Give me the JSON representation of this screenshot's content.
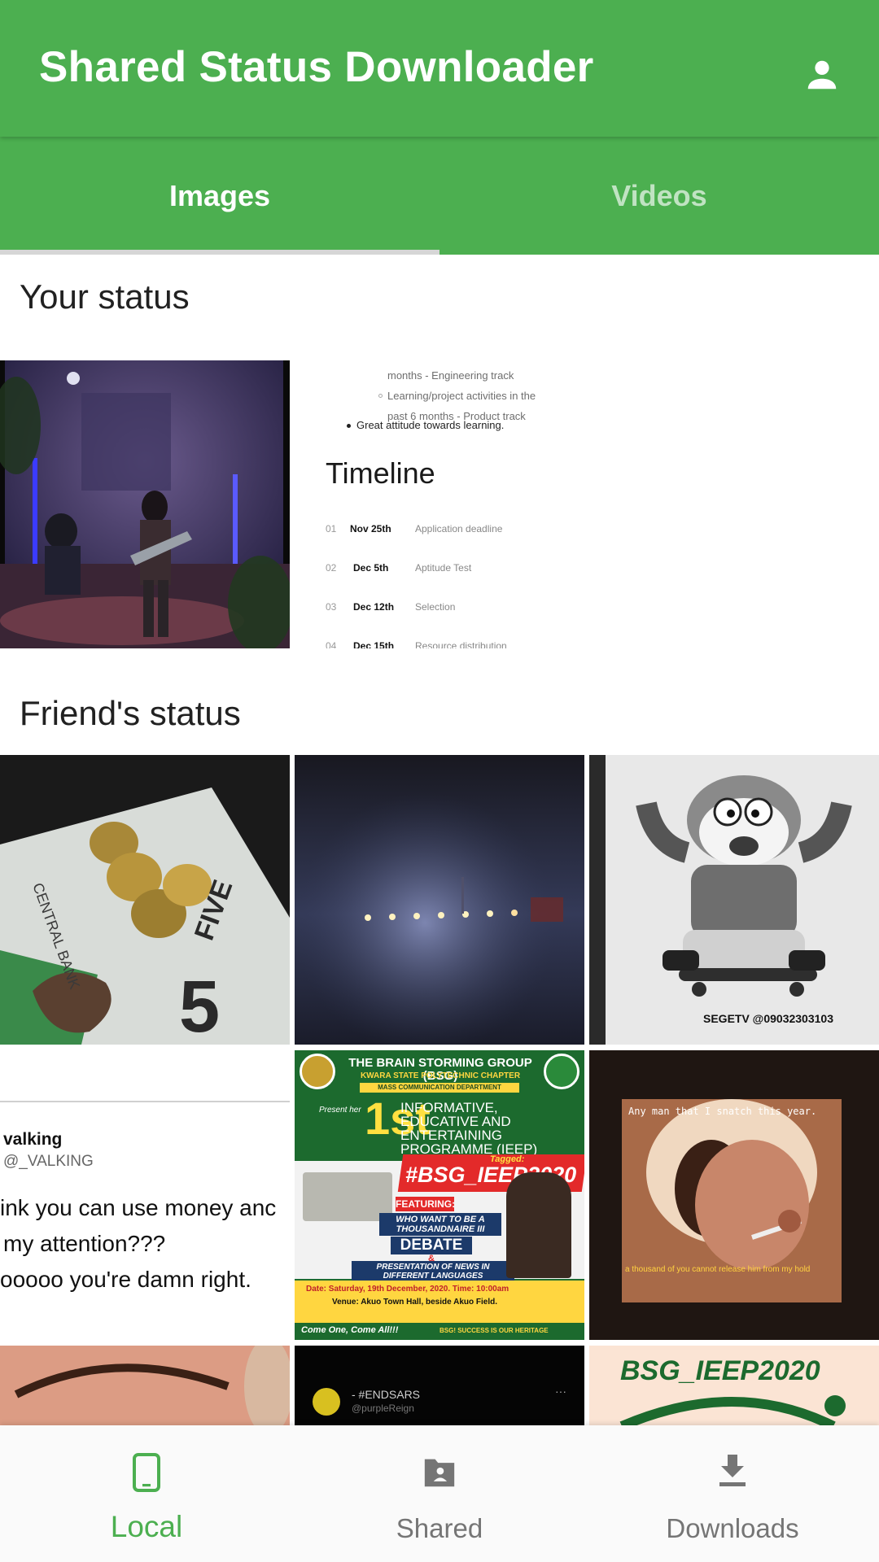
{
  "appbar": {
    "title": "Shared Status Downloader",
    "account_icon": "account-icon"
  },
  "tabs": [
    {
      "label": "Images",
      "active": true
    },
    {
      "label": "Videos",
      "active": false
    }
  ],
  "sections": {
    "your_status": "Your status",
    "friends_status": "Friend's status"
  },
  "your_status_images": {
    "timeline_card": {
      "bullets_top": [
        "months - Engineering track",
        "Learning/project activities in the",
        "past 6 months - Product track"
      ],
      "bullet_main": "Great attitude towards learning.",
      "heading": "Timeline",
      "rows": [
        {
          "num": "01",
          "date": "Nov 25th",
          "desc": "Application deadline"
        },
        {
          "num": "02",
          "date": "Dec 5th",
          "desc": "Aptitude Test"
        },
        {
          "num": "03",
          "date": "Dec 12th",
          "desc": "Selection"
        },
        {
          "num": "04",
          "date": "Dec 15th",
          "desc": "Resource distribution"
        }
      ]
    }
  },
  "friends_images": {
    "tweet": {
      "name": "valking",
      "handle": "@_VALKING",
      "lines": [
        "ink you can use money anc",
        "my attention???",
        "ooooo you're damn right."
      ]
    },
    "poster": {
      "title": "THE BRAIN STORMING GROUP (BSG)",
      "chapter": "KWARA STATE POLYTECHNIC CHAPTER",
      "dept": "MASS COMMUNICATION DEPARTMENT",
      "present": "Present her",
      "first": "1st",
      "program": "INFORMATIVE, EDUCATIVE AND ENTERTAINING PROGRAMME (IEEP)",
      "tagged": "Tagged:",
      "hashtag": "#BSG_IEEP2020",
      "featuring": "FEATURING:",
      "feature1": "WHO WANT TO BE A THOUSANDNAIRE III",
      "debate": "DEBATE",
      "amp": "&",
      "news": "PRESENTATION OF NEWS IN DIFFERENT LANGUAGES",
      "date_line": "Date: Saturday, 19th December, 2020.   Time: 10:00am",
      "venue_line": "Venue: Akuo Town Hall, beside Akuo Field.",
      "footer_left": "Come One, Come All!!!",
      "footer_right": "BSG! SUCCESS IS OUR HERITAGE"
    },
    "sketch_watermark": "SEGETV @09032303103",
    "movie_top": "Any man that I snatch this year.",
    "movie_bottom": "a thousand of you cannot release him from my hold",
    "endsars": "- #ENDSARS",
    "endsars_handle": "@purpleReign",
    "bsg_banner": "BSG_IEEP2020"
  },
  "bottom_nav": [
    {
      "label": "Local",
      "icon": "phone-icon",
      "active": true
    },
    {
      "label": "Shared",
      "icon": "shared-folder-icon",
      "active": false
    },
    {
      "label": "Downloads",
      "icon": "download-icon",
      "active": false
    }
  ],
  "colors": {
    "primary": "#4caf50",
    "inactive": "#757575"
  }
}
